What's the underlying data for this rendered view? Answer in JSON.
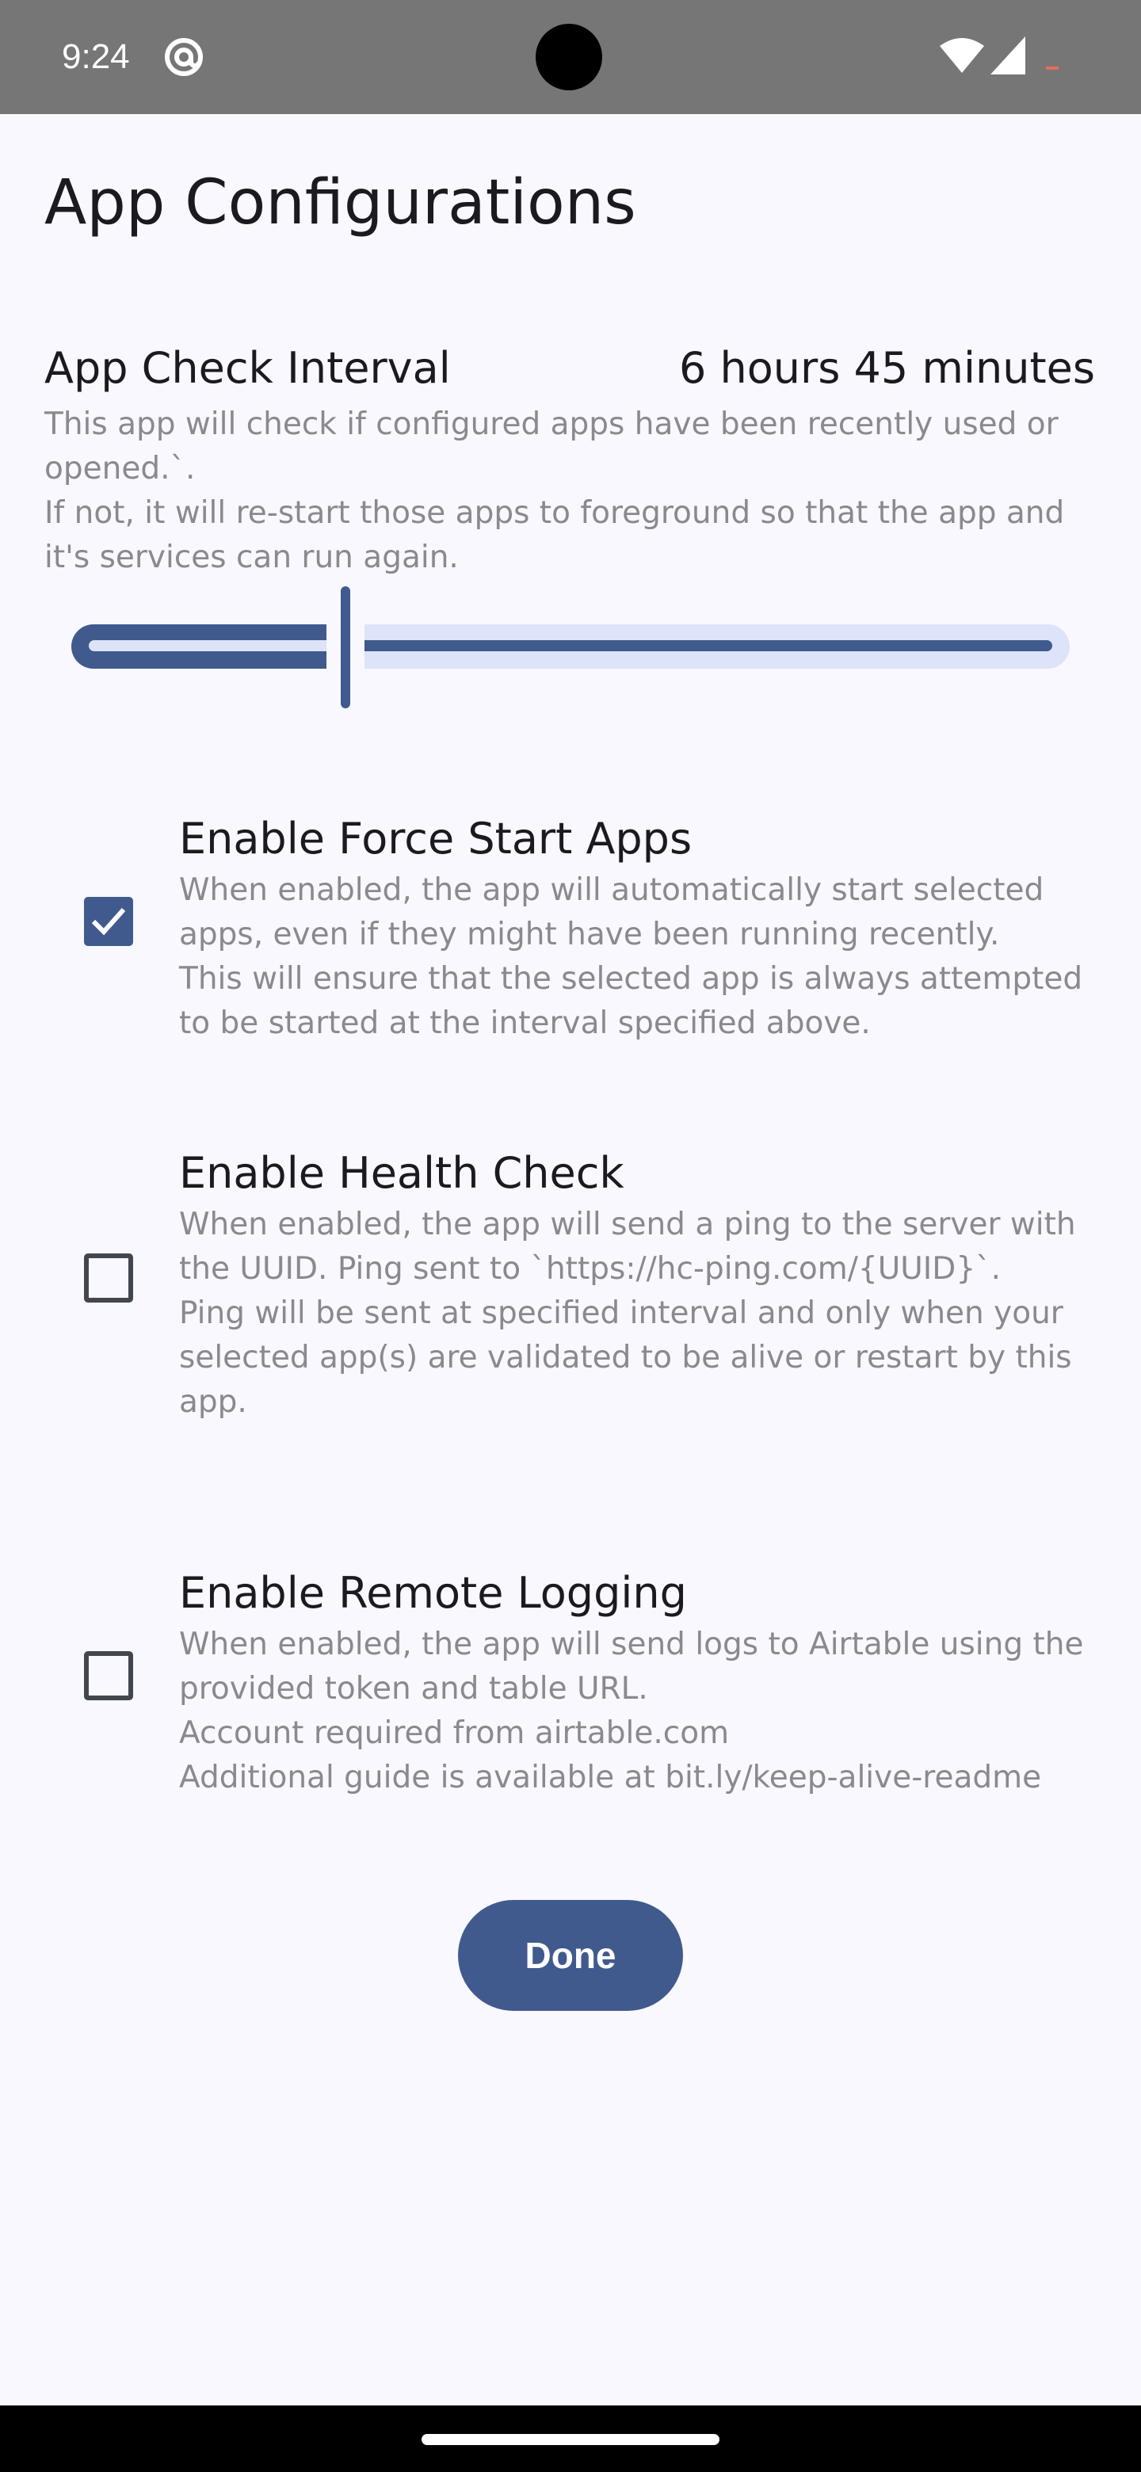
{
  "status_bar": {
    "time": "9:24",
    "icons": [
      "at-sign-icon",
      "wifi-icon",
      "signal-icon",
      "battery-icon"
    ],
    "background": "#767676"
  },
  "page": {
    "title": "App Configurations",
    "background": "#f8f8fe",
    "accent": "#415a8e"
  },
  "interval": {
    "label": "App Check Interval",
    "value": "6 hours 45 minutes",
    "description": [
      "This app will check if configured apps have been recently used or opened.`.",
      "If not, it will re-start those apps to foreground so that the app and it's services can run again."
    ],
    "slider_fraction": 0.27
  },
  "options": [
    {
      "title": "Enable Force Start Apps",
      "checked": true,
      "description": [
        "When enabled, the app will automatically start selected apps, even if they might have been running recently.",
        "This will ensure that the selected app is always attempted to be started at the interval specified above."
      ]
    },
    {
      "title": "Enable Health Check",
      "checked": false,
      "description": [
        "When enabled, the app will send a ping to the server with the UUID. Ping sent to `https://hc-ping.com/{UUID}`.",
        "Ping will be sent at specified interval and only when your selected app(s) are validated to be alive or restart by this app."
      ]
    },
    {
      "title": "Enable Remote Logging",
      "checked": false,
      "description": [
        "When enabled, the app will send logs to Airtable using the provided token and table URL.",
        "Account required from airtable.com",
        "Additional guide is available at bit.ly/keep-alive-readme"
      ]
    }
  ],
  "done_button": {
    "label": "Done"
  }
}
